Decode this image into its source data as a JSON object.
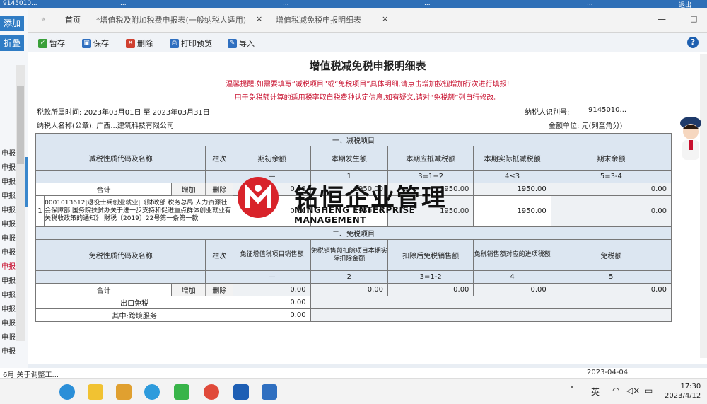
{
  "topbar": {
    "left_id": "9145010...",
    "tab1": "...",
    "mid1": "...",
    "mid2": "...",
    "right": "...",
    "logout": "退出"
  },
  "leftpanel": {
    "add_btn": "添加",
    "fold_btn": "折叠",
    "items": [
      "申报",
      "申报",
      "申报",
      "申报",
      "申报",
      "申报",
      "申报",
      "申报",
      "申报",
      "申报",
      "申报",
      "申报",
      "申报",
      "申报",
      "申报",
      "申报"
    ]
  },
  "tabs": {
    "home": "首页",
    "tab1": "*增值税及附加税费申报表(一般纳税人适用)",
    "tab2": "增值税减免税申报明细表"
  },
  "toolbar": {
    "save_temp": "暂存",
    "save": "保存",
    "delete": "删除",
    "print": "打印预览",
    "import": "导入"
  },
  "form": {
    "title": "增值税减免税申报明细表",
    "warn1": "温馨提醒:如需要填写“减税项目”或“免税项目”具体明细,请点击增加按钮增加行次进行填报!",
    "warn2": "用于免税额计算的适用税率取自税费种认定信息,如有疑义,请对“免税额”列自行修改。",
    "period": "税款所属时间: 2023年03月01日 至 2023年03月31日",
    "taxpayer_id_label": "纳税人识别号:",
    "taxpayer_id": "9145010...",
    "taxpayer_name": "纳税人名称(公章): 广西...建筑科技有限公司",
    "unit": "金额单位: 元(列至角分)"
  },
  "reduce": {
    "section": "一、减税项目",
    "headers": [
      "减税性质代码及名称",
      "栏次",
      "期初余额",
      "本期发生额",
      "本期应抵减税额",
      "本期实际抵减税额",
      "期末余额"
    ],
    "colnums": [
      "—",
      "1",
      "2",
      "3=1+2",
      "4≤3",
      "5=3-4"
    ],
    "total_label": "合计",
    "add": "增加",
    "del": "删除",
    "total_vals": [
      "0.00",
      "1950.00",
      "1950.00",
      "1950.00",
      "0.00"
    ],
    "row_index": "1",
    "row_code": "0001013612|退役士兵创业就业|《财政部 税务总局 人力资源社会保障部 国务院扶贫办关于进一步支持和促进重点群体创业就业有关税收政策的通知》 财税〔2019〕22号第一条第一款",
    "row_vals": [
      "0.00",
      "1950.00",
      "1950.00",
      "1950.00",
      "0.00"
    ]
  },
  "exempt": {
    "section": "二、免税项目",
    "headers": [
      "免税性质代码及名称",
      "栏次",
      "免征增值税项目销售额",
      "免税销售额扣除项目本期实际扣除金额",
      "扣除后免税销售额",
      "免税销售额对应的进项税额",
      "免税额"
    ],
    "colnums": [
      "—",
      "1",
      "2",
      "3=1-2",
      "4",
      "5"
    ],
    "total_label": "合计",
    "add": "增加",
    "del": "删除",
    "total_vals": [
      "0.00",
      "0.00",
      "0.00",
      "0.00",
      "0.00"
    ],
    "export_label": "出口免税",
    "export_val": "0.00",
    "intl_label": "其中:跨境服务",
    "intl_val": "0.00"
  },
  "logo": {
    "cn": "铭恒企业管理",
    "en": "MINGHENG ENTERPRISE MANAGEMENT"
  },
  "notice": {
    "left": "6月 关于调整工...",
    "date": "2023-04-04"
  },
  "taskbar": {
    "lang": "英",
    "time": "17:30",
    "date": "2023/4/12"
  }
}
